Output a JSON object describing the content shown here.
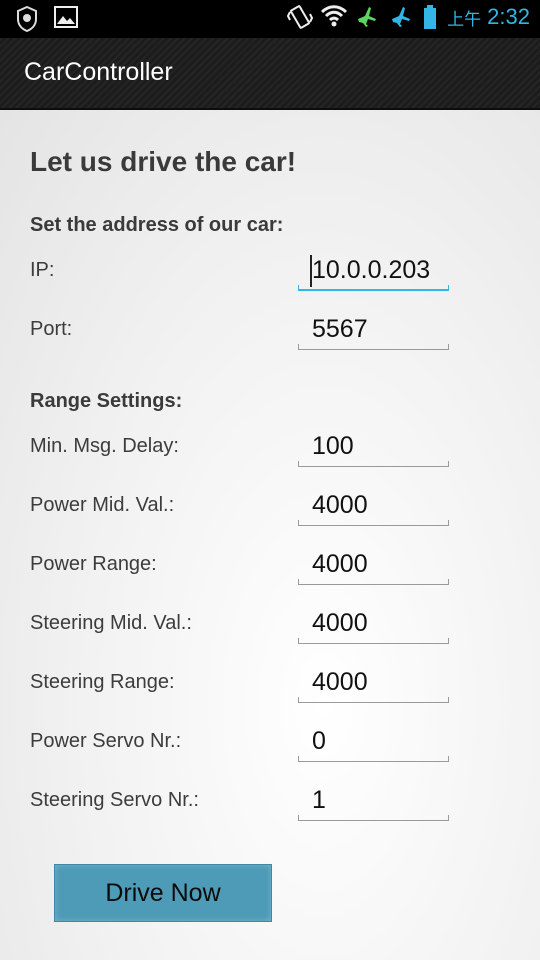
{
  "status_bar": {
    "left_icons": [
      "security-shield-icon",
      "image-icon"
    ],
    "right_icons": [
      "vibrate-icon",
      "wifi-icon",
      "airplane-mode-icon",
      "airplane-mode-icon"
    ],
    "ampm": "上午",
    "time": "2:32",
    "accent_color": "#33b5e5"
  },
  "action_bar": {
    "title": "CarController"
  },
  "main": {
    "headline": "Let us drive the car!",
    "address_section": "Set the address of our car:",
    "address_fields": [
      {
        "label": "IP:",
        "value": "10.0.0.203"
      },
      {
        "label": "Port:",
        "value": "5567"
      }
    ],
    "range_section": "Range Settings:",
    "range_fields": [
      {
        "label": "Min. Msg. Delay:",
        "value": "100"
      },
      {
        "label": "Power Mid. Val.:",
        "value": "4000"
      },
      {
        "label": "Power Range:",
        "value": "4000"
      },
      {
        "label": "Steering Mid. Val.:",
        "value": "4000"
      },
      {
        "label": "Steering Range:",
        "value": "4000"
      },
      {
        "label": "Power Servo Nr.:",
        "value": "0"
      },
      {
        "label": "Steering Servo Nr.:",
        "value": "1"
      }
    ],
    "drive_button": "Drive Now",
    "button_color": "#4e9bb8"
  }
}
